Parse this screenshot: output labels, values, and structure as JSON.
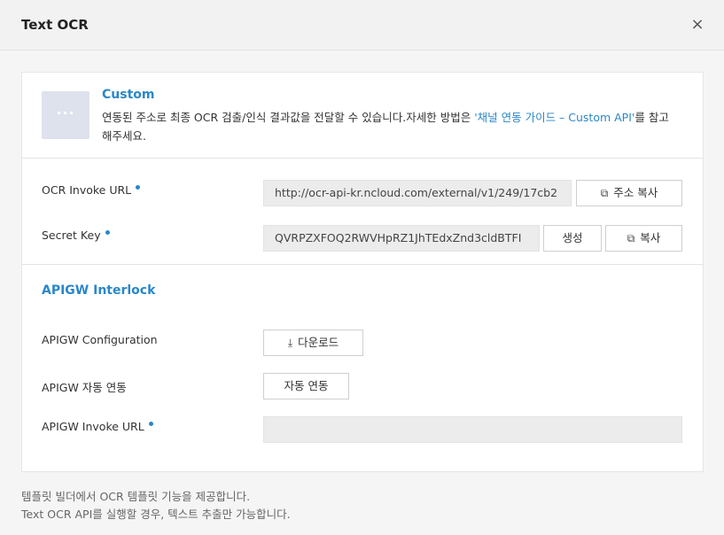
{
  "dialog": {
    "title": "Text OCR",
    "close_icon": "×"
  },
  "custom": {
    "icon_text": "···",
    "title": "Custom",
    "desc_prefix": "연동된 주소로 최종 OCR 검출/인식 결과값을 전달할 수 있습니다.자세한 방법은 ",
    "desc_link": "'채널 연동 가이드 – Custom API'",
    "desc_suffix": "를 참고해주세요."
  },
  "ocr_invoke": {
    "label": "OCR Invoke URL",
    "value": "http://ocr-api-kr.ncloud.com/external/v1/249/17cb2",
    "copy_button": "주소 복사"
  },
  "secret_key": {
    "label": "Secret Key",
    "value": "QVRPZXFOQ2RWVHpRZ1JhTEdxZnd3cldBTFI",
    "generate_button": "생성",
    "copy_button": "복사"
  },
  "apigw": {
    "title": "APIGW Interlock",
    "config_label": "APIGW Configuration",
    "download_button": "다운로드",
    "auto_label": "APIGW 자동 연동",
    "auto_button": "자동 연동",
    "invoke_label": "APIGW Invoke URL",
    "invoke_value": ""
  },
  "footer": {
    "line1": "템플릿 빌더에서 OCR 템플릿 기능을 제공합니다.",
    "line2": "Text OCR API를 실행할 경우, 텍스트 추출만 가능합니다."
  }
}
